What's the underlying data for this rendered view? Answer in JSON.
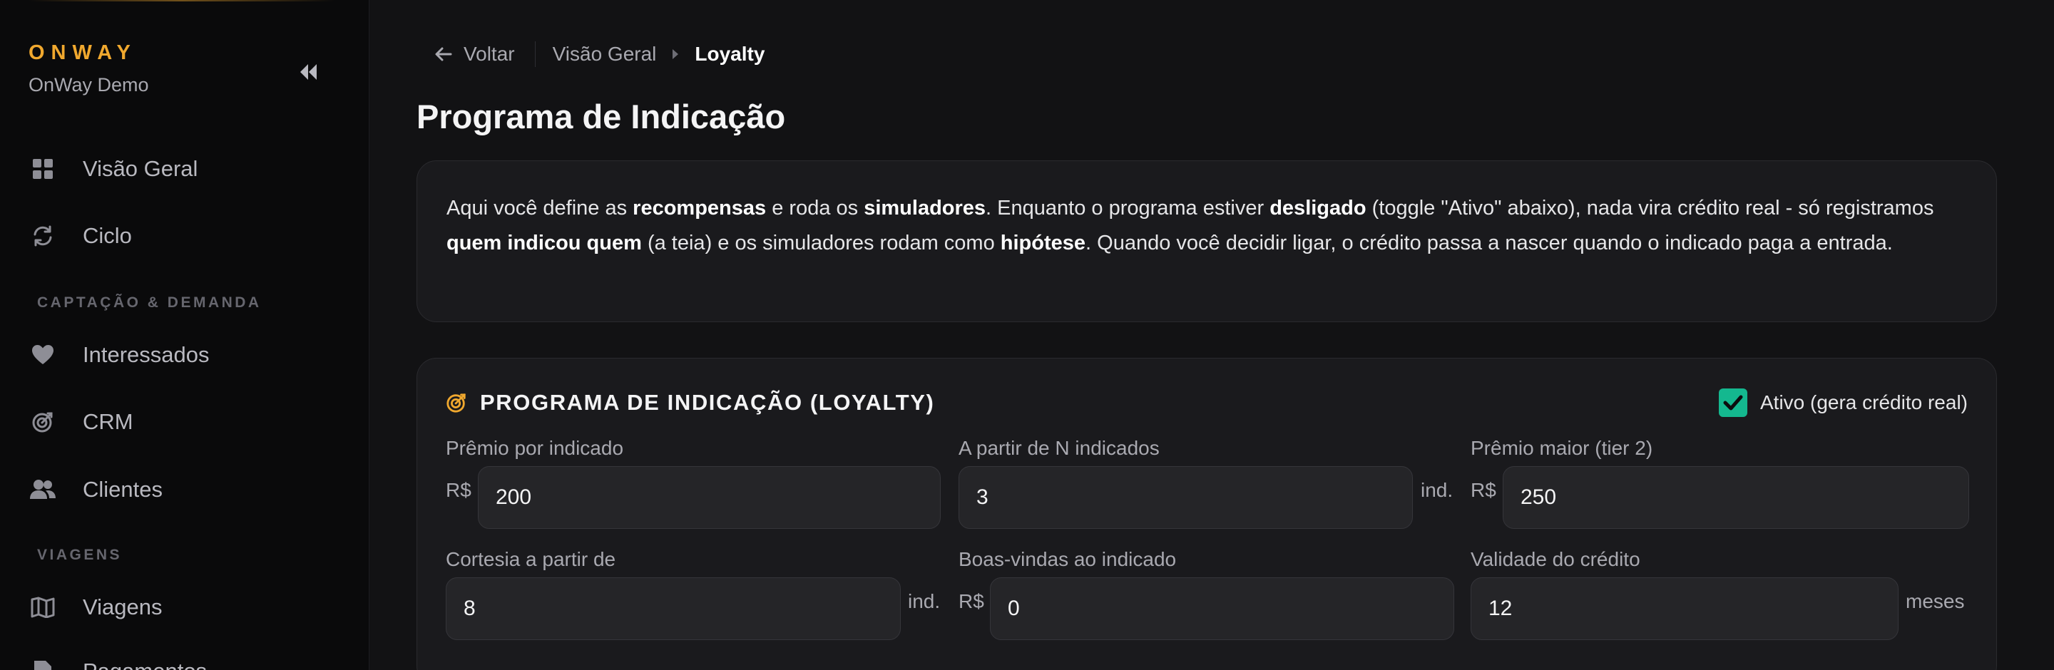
{
  "sidebar": {
    "brand": "ONWAY",
    "account": "OnWay Demo",
    "items": [
      {
        "label": "Visão Geral",
        "icon": "grid-icon"
      },
      {
        "label": "Ciclo",
        "icon": "refresh-icon"
      },
      {
        "label": "Interessados",
        "icon": "heart-icon"
      },
      {
        "label": "CRM",
        "icon": "target-icon"
      },
      {
        "label": "Clientes",
        "icon": "users-icon"
      },
      {
        "label": "Viagens",
        "icon": "map-icon"
      },
      {
        "label": "Pagamentos",
        "icon": "document-icon"
      }
    ],
    "sections": [
      "CAPTAÇÃO & DEMANDA",
      "VIAGENS"
    ]
  },
  "topbar": {
    "back_label": "Voltar",
    "breadcrumb_parent": "Visão Geral",
    "breadcrumb_current": "Loyalty"
  },
  "page_title": "Programa de Indicação",
  "info": {
    "t1": "Aqui você define as ",
    "b1": "recompensas",
    "t2": " e roda os ",
    "b2": "simuladores",
    "t3": ". Enquanto o programa estiver ",
    "b3": "desligado",
    "t4": " (toggle \"Ativo\" abaixo), nada vira crédito real - só registramos ",
    "b4": "quem indicou quem",
    "t5": " (a teia) e os simuladores rodam como ",
    "b5": "hipótese",
    "t6": ". Quando você decidir ligar, o crédito passa a nascer quando o indicado paga a entrada."
  },
  "loyalty": {
    "title": "PROGRAMA DE INDICAÇÃO (LOYALTY)",
    "active_label": "Ativo (gera crédito real)",
    "active": true,
    "fields": {
      "reward": {
        "label": "Prêmio por indicado",
        "prefix": "R$",
        "value": "200"
      },
      "threshold": {
        "label": "A partir de N indicados",
        "suffix": "ind.",
        "value": "3"
      },
      "tier2": {
        "label": "Prêmio maior (tier 2)",
        "prefix": "R$",
        "value": "250"
      },
      "courtesy": {
        "label": "Cortesia a partir de",
        "suffix": "ind.",
        "value": "8"
      },
      "welcome": {
        "label": "Boas-vindas ao indicado",
        "prefix": "R$",
        "value": "0"
      },
      "validity": {
        "label": "Validade do crédito",
        "suffix": "meses",
        "value": "12"
      }
    }
  },
  "colors": {
    "accent": "#f0a82e",
    "success": "#14b88f",
    "background": "#121214",
    "card": "#1a1a1d"
  }
}
